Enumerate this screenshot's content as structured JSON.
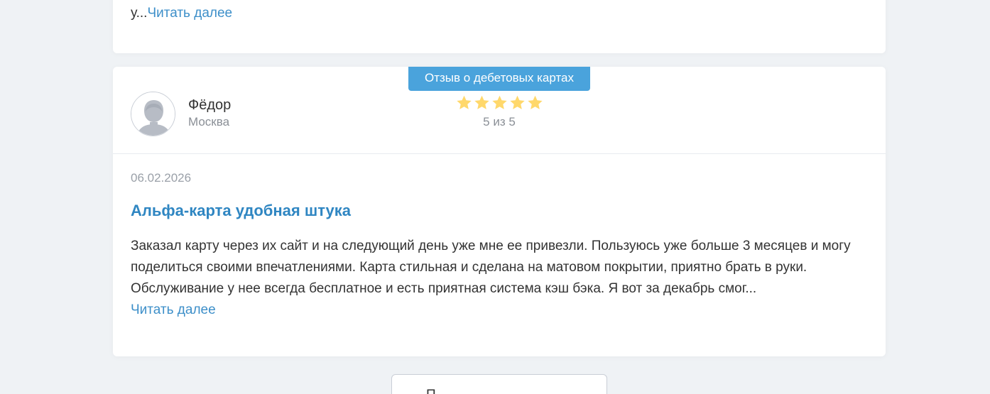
{
  "previous_review": {
    "text_tail": "у...",
    "read_more_label": "Читать далее"
  },
  "review": {
    "category_tag": "Отзыв о дебетовых картах",
    "author": {
      "name": "Фёдор",
      "city": "Москва",
      "avatar_icon": "user-silhouette-icon"
    },
    "rating": {
      "value": 5,
      "max": 5,
      "text": "5 из 5",
      "star_color": "#ffd86b"
    },
    "date": "06.02.2026",
    "title": "Альфа-карта удобная штука",
    "body": "Заказал карту через их сайт и на следующий день уже мне ее привезли. Пользуюсь уже больше 3 месяцев и могу поделиться своими впечатлениями. Карта стильная и сделана на матовом покрытии, приятно брать в руки. Обслуживание у нее всегда бесплатное и есть приятная система кэш бэка. Я вот за декабрь смог...",
    "read_more_label": "Читать далее"
  },
  "more_button": {
    "label": "П"
  },
  "colors": {
    "accent": "#4aa3dc",
    "link": "#3d8fc9",
    "title": "#2f86c2",
    "background": "#eff2f5"
  }
}
